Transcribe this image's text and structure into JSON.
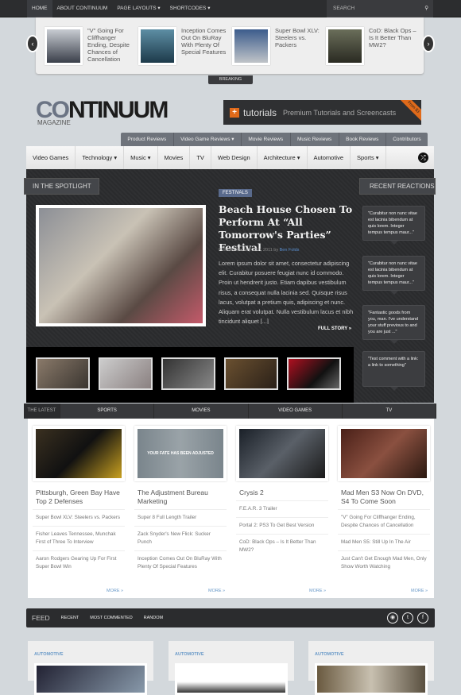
{
  "topnav": {
    "items": [
      "HOME",
      "ABOUT CONTINUUM",
      "PAGE LAYOUTS ▾",
      "SHORTCODES ▾"
    ],
    "search_placeholder": "SEARCH"
  },
  "breaking": {
    "label": "BREAKING",
    "items": [
      "\"V\" Going For Cliffhanger Ending, Despite Chances of Cancellation",
      "Inception Comes Out On BluRay With Plenty Of Special Features",
      "Super Bowl XLV: Steelers vs. Packers",
      "CoD: Black Ops – Is It Better Than MW2?"
    ]
  },
  "logo": {
    "main": "CONTINUUM",
    "sub": "MAGAZINE"
  },
  "ad": {
    "brand": "tutorials",
    "tagline": "Premium Tutorials and Screencasts",
    "ribbon": "From $3"
  },
  "subnav": [
    "Product Reviews",
    "Video Game Reviews ▾",
    "Movie Reviews",
    "Music Reviews",
    "Book Reviews",
    "Contributors"
  ],
  "mainnav": [
    "Video Games",
    "Technology ▾",
    "Music ▾",
    "Movies",
    "TV",
    "Web Design",
    "Architecture ▾",
    "Automotive",
    "Sports ▾"
  ],
  "spotlight": {
    "label": "IN THE SPOTLIGHT",
    "badge": "FESTIVALS",
    "title": "Beach House Chosen To Perform At “All Tomorrow's Parties” Festival",
    "posted": "Posted February 15th, 2011 by ",
    "author": "Ben Folds",
    "body": "Lorem ipsum dolor sit amet, consectetur adipiscing elit. Curabitur posuere feugiat nunc id commodo. Proin ut hendrerit justo. Etiam dapibus vestibulum risus, a consequat nulla lacinia sed. Quisque risus lacus, volutpat a pretium quis, adipiscing et nunc. Aliquam erat volutpat. Nulla vestibulum lacus et nibh tincidunt aliquet [...]",
    "full_story": "FULL STORY »"
  },
  "reactions": {
    "label": "RECENT REACTIONS",
    "items": [
      "\"Curabitur non nunc vitae est lacinia bibendum at quis lorem. Integer tempus tempus maur...\"",
      "\"Curabitur non nunc vitae est lacinia bibendum at quis lorem. Integer tempus tempus maur...\"",
      "\"Fantastic goods from you, man. I've understand your stuff previous to and you are just ...\"",
      "\"Test comment with a link: a link to something\""
    ]
  },
  "latest": {
    "label": "THE LATEST",
    "columns": [
      {
        "tab": "SPORTS",
        "title": "Pittsburgh, Green Bay Have Top 2 Defenses",
        "links": [
          "Super Bowl XLV: Steelers vs. Packers",
          "Fisher Leaves Tennessee, Munchak First of Three To Interview",
          "Aaron Rodgers Gearing Up For First Super Bowl Win"
        ],
        "more": "MORE »"
      },
      {
        "tab": "MOVIES",
        "title": "The Adjustment Bureau Marketing",
        "image_text": "YOUR FATE HAS BEEN ADJUSTED",
        "links": [
          "Super 8 Full Length Trailer",
          "Zack Snyder's New Flick: Sucker Punch",
          "Inception Comes Out On BluRay With Plenty Of Special Features"
        ],
        "more": "MORE »"
      },
      {
        "tab": "VIDEO GAMES",
        "title": "Crysis 2",
        "links": [
          "F.E.A.R. 3 Trailer",
          "Portal 2: PS3 To Get Best Version",
          "CoD: Black Ops – Is It Better Than MW2?"
        ],
        "more": "MORE »"
      },
      {
        "tab": "TV",
        "title": "Mad Men S3 Now On DVD, S4 To Come Soon",
        "links": [
          "\"V\" Going For Cliffhanger Ending, Despite Chances of Cancellation",
          "Mad Men S5: Still Up In The Air",
          "Just Can't Get Enough Mad Men, Only Show Worth Watching"
        ],
        "more": "MORE »"
      }
    ]
  },
  "feed": {
    "label": "FEED",
    "tabs": [
      "RECENT",
      "MOST COMMENTED",
      "RANDOM"
    ],
    "cards": [
      "AUTOMOTIVE",
      "AUTOMOTIVE",
      "AUTOMOTIVE"
    ]
  }
}
